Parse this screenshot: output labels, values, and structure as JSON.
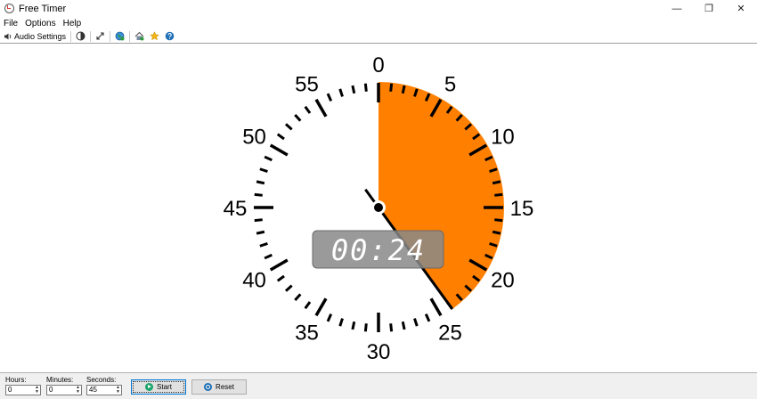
{
  "window": {
    "title": "Free Timer",
    "controls": {
      "minimize": "—",
      "restore": "❐",
      "close": "✕"
    }
  },
  "menu": {
    "items": [
      "File",
      "Options",
      "Help"
    ]
  },
  "toolbar": {
    "audio_settings_label": "Audio Settings"
  },
  "clock": {
    "minute_labels": [
      "0",
      "5",
      "10",
      "15",
      "20",
      "25",
      "30",
      "35",
      "40",
      "45",
      "50",
      "55"
    ],
    "remaining_seconds": 24,
    "elapsed_seconds": 21,
    "set_seconds": 45,
    "display_time": "00:24",
    "colors": {
      "sector": "#ff8000",
      "sector_edge": "#f07000",
      "ticks": "#000000",
      "hand": "#000000",
      "display_bg": "#888888",
      "display_text": "#ffffff"
    }
  },
  "bottom": {
    "hours": {
      "label": "Hours:",
      "value": "0"
    },
    "minutes": {
      "label": "Minutes:",
      "value": "0"
    },
    "seconds": {
      "label": "Seconds:",
      "value": "45"
    },
    "start_label": "Start",
    "reset_label": "Reset"
  }
}
